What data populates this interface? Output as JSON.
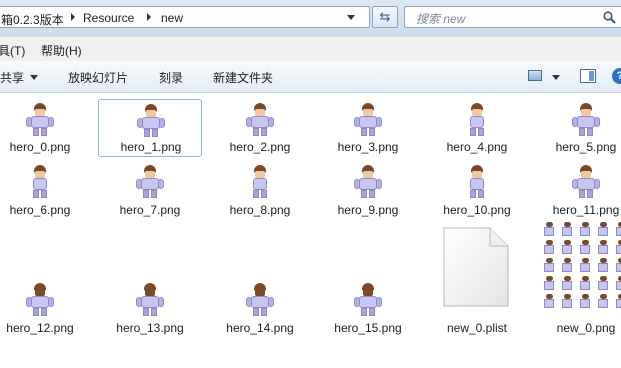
{
  "address": {
    "crumbs": [
      "箱0.2.3版本",
      "Resource",
      "new"
    ]
  },
  "search": {
    "placeholder": "搜索 new",
    "icon": "search-icon"
  },
  "refresh": {
    "icon": "refresh-icon"
  },
  "menu": {
    "items": [
      "具(T)",
      "帮助(H)"
    ]
  },
  "commands": {
    "share_label": "共享",
    "slideshow_label": "放映幻灯片",
    "burn_label": "刻录",
    "new_folder_label": "新建文件夹",
    "view_icon": "view-options-icon",
    "preview_pane_icon": "preview-pane-icon",
    "help_icon": "help-icon"
  },
  "files": [
    {
      "name": "hero_0.png",
      "pose": "front"
    },
    {
      "name": "hero_1.png",
      "pose": "front"
    },
    {
      "name": "hero_2.png",
      "pose": "front"
    },
    {
      "name": "hero_3.png",
      "pose": "front"
    },
    {
      "name": "hero_4.png",
      "pose": "side"
    },
    {
      "name": "hero_5.png",
      "pose": "front"
    },
    {
      "name": "hero_6.png",
      "pose": "side"
    },
    {
      "name": "hero_7.png",
      "pose": "front"
    },
    {
      "name": "hero_8.png",
      "pose": "side"
    },
    {
      "name": "hero_9.png",
      "pose": "front"
    },
    {
      "name": "hero_10.png",
      "pose": "side"
    },
    {
      "name": "hero_11.png",
      "pose": "front"
    },
    {
      "name": "hero_12.png",
      "pose": "back"
    },
    {
      "name": "hero_13.png",
      "pose": "back"
    },
    {
      "name": "hero_14.png",
      "pose": "back"
    },
    {
      "name": "hero_15.png",
      "pose": "back"
    },
    {
      "name": "new_0.plist",
      "pose": "document"
    },
    {
      "name": "new_0.png",
      "pose": "spritesheet"
    }
  ],
  "selected_file": "hero_1.png"
}
